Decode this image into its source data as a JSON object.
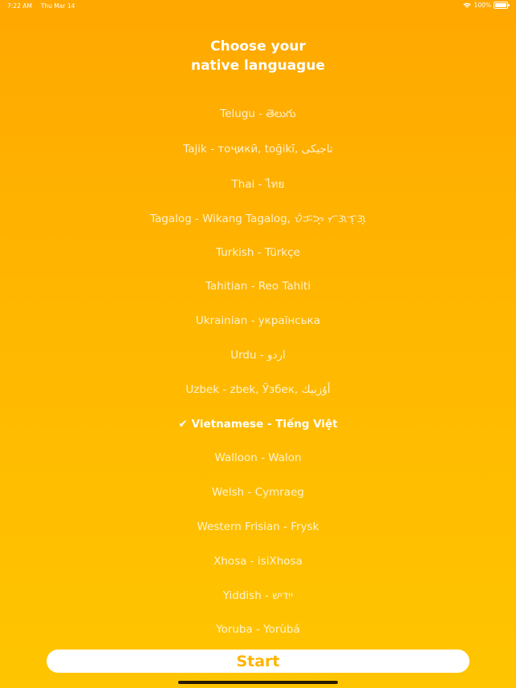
{
  "status_bar": {
    "time": "7:22 AM",
    "date": "Thu Mar 14",
    "battery": "100%"
  },
  "title": {
    "line1": "Choose your",
    "line2": "native languague"
  },
  "languages": [
    {
      "label": "Telugu - తెలుగు"
    },
    {
      "label": "Tajik - тоҷикӣ, toğikī, تاجیکی"
    },
    {
      "label": "Thai - ไทย"
    },
    {
      "label": "Tagalog - Wikang Tagalog, ᜏᜒᜃᜅ᜔ ᜆᜄᜎᜓᜄ᜔"
    },
    {
      "label": "Turkish - Türkçe"
    },
    {
      "label": "Tahitian - Reo Tahiti"
    },
    {
      "label": "Ukrainian - українська"
    },
    {
      "label": "Urdu - اردو"
    },
    {
      "label": "Uzbek - zbek, Ўзбек, أۇزبېك"
    },
    {
      "label": "Vietnamese - Tiếng Việt",
      "selected": true,
      "check": "✔"
    },
    {
      "label": "Walloon - Walon"
    },
    {
      "label": "Welsh - Cymraeg"
    },
    {
      "label": "Western Frisian - Frysk"
    },
    {
      "label": "Xhosa - isiXhosa"
    },
    {
      "label": "Yiddish - ייִדיש"
    },
    {
      "label": "Yoruba - Yorùbá"
    }
  ],
  "start_button": {
    "label": "Start"
  },
  "colors": {
    "gradient_top": "#FFA800",
    "gradient_bottom": "#FFC500",
    "accent": "#FFB400",
    "text": "#FFFFFF"
  }
}
